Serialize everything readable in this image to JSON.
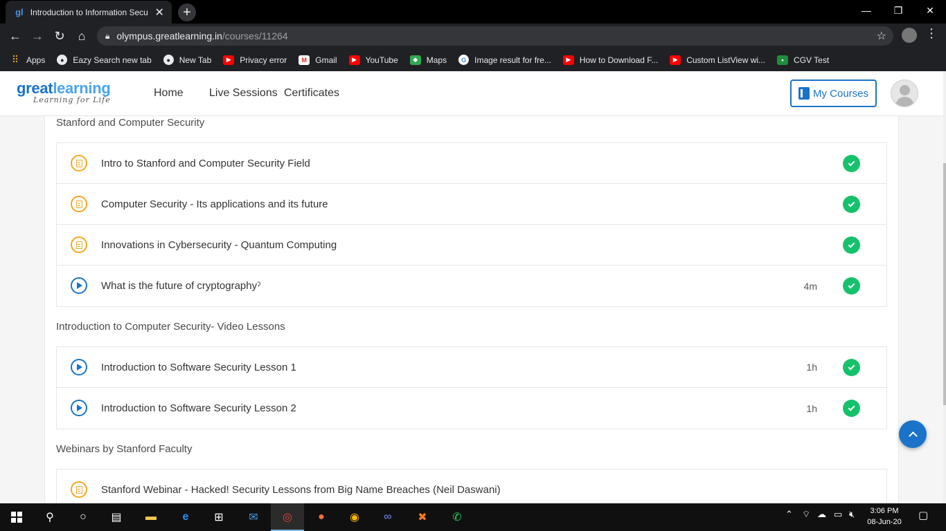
{
  "browser": {
    "tab_title": "Introduction to Information Secu",
    "tab_favicon": "gl",
    "url_host": "olympus.greatlearning.in",
    "url_path": "/courses/11264",
    "bookmarks": [
      {
        "label": "Apps",
        "icon": "apps-icon"
      },
      {
        "label": "Eazy Search new tab",
        "icon": "globe-icon"
      },
      {
        "label": "New Tab",
        "icon": "globe-icon"
      },
      {
        "label": "Privacy error",
        "icon": "youtube-icon"
      },
      {
        "label": "Gmail",
        "icon": "gmail-icon"
      },
      {
        "label": "YouTube",
        "icon": "youtube-icon"
      },
      {
        "label": "Maps",
        "icon": "maps-icon"
      },
      {
        "label": "Image result for fre...",
        "icon": "google-icon"
      },
      {
        "label": "How to Download F...",
        "icon": "youtube-icon"
      },
      {
        "label": "Custom ListView wi...",
        "icon": "youtube-icon"
      },
      {
        "label": "CGV Test",
        "icon": "classroom-icon"
      }
    ]
  },
  "header": {
    "logo_main_a": "great",
    "logo_main_b": "learning",
    "logo_sub": "Learning for Life",
    "nav": [
      "Home",
      "Live Sessions",
      "Certificates"
    ],
    "my_courses": "My Courses"
  },
  "sections": [
    {
      "title": "Stanford and Computer Security",
      "items": [
        {
          "type": "document",
          "title": "Intro to Stanford and Computer Security Field",
          "duration": "",
          "completed": true
        },
        {
          "type": "document",
          "title": "Computer Security - Its applications and its future",
          "duration": "",
          "completed": true
        },
        {
          "type": "document",
          "title": "Innovations in Cybersecurity - Quantum Computing",
          "duration": "",
          "completed": true
        },
        {
          "type": "video",
          "title": "What is the future of cryptographyˀ",
          "duration": "4m",
          "completed": true
        }
      ]
    },
    {
      "title": "Introduction to Computer Security- Video Lessons",
      "items": [
        {
          "type": "video",
          "title": "Introduction to Software Security Lesson 1",
          "duration": "1h",
          "completed": true
        },
        {
          "type": "video",
          "title": "Introduction to Software Security Lesson 2",
          "duration": "1h",
          "completed": true
        }
      ]
    },
    {
      "title": "Webinars by Stanford Faculty",
      "items": [
        {
          "type": "document",
          "title": "Stanford Webinar - Hacked! Security Lessons from Big Name Breaches (Neil Daswani)",
          "duration": "",
          "completed": false
        }
      ]
    }
  ],
  "taskbar": {
    "time": "3:06 PM",
    "date": "08-Jun-20"
  },
  "colors": {
    "brand_blue": "#1a73c8",
    "doc_orange": "#f5a623",
    "complete_green": "#15c26b"
  }
}
